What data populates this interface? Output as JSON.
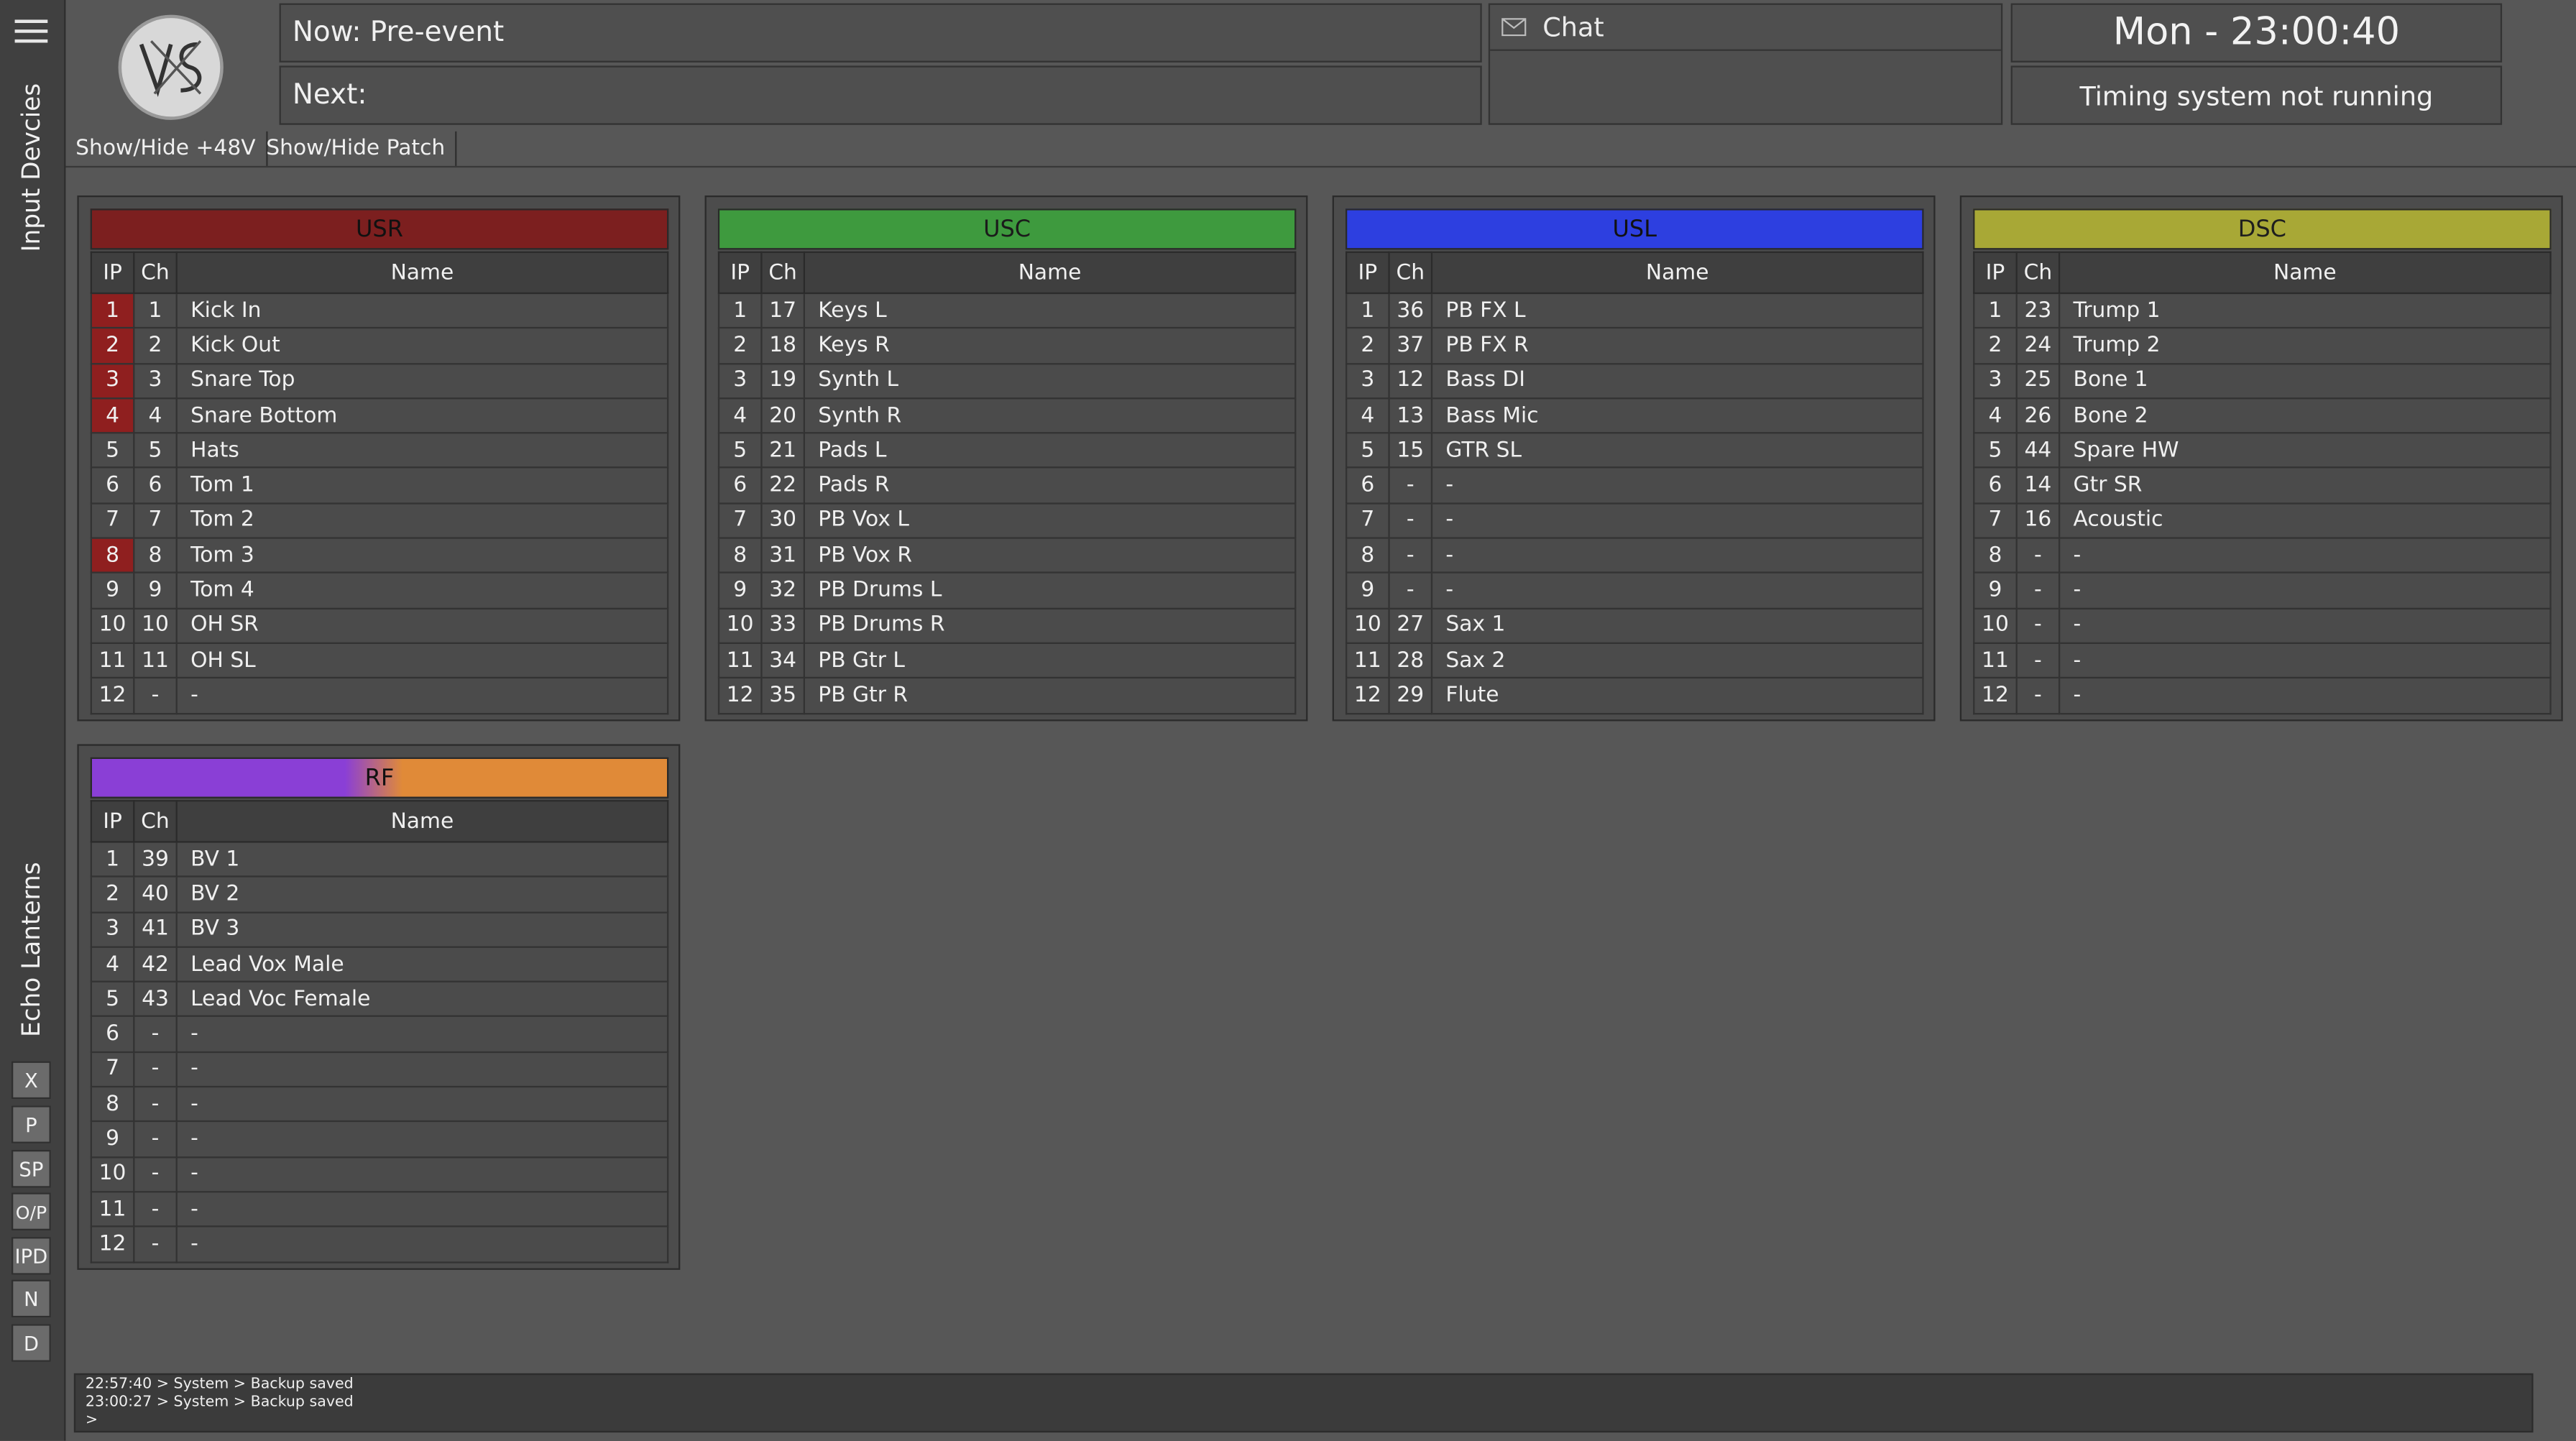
{
  "sidebar": {
    "tabs": [
      "Input Devcies",
      "Echo Lanterns"
    ],
    "buttons": [
      "X",
      "P",
      "SP",
      "O/P",
      "IPD",
      "N",
      "D"
    ]
  },
  "header": {
    "now_label": "Now: Pre-event",
    "next_label": "Next:",
    "chat_label": "Chat",
    "time": "Mon - 23:00:40",
    "timing_status": "Timing system not running"
  },
  "toolbar": {
    "show_hide_48v": "Show/Hide +48V",
    "show_hide_patch": "Show/Hide Patch"
  },
  "columns": {
    "ip": "IP",
    "ch": "Ch",
    "name": "Name"
  },
  "colors": {
    "usr": "#7c1f1f",
    "usc": "#3e9a3e",
    "usl": "#2d3fe0",
    "dsc": "#a8a836",
    "rf_left": "#8a3fd6",
    "rf_right": "#e08a38",
    "highlight": "#8f1f1f"
  },
  "panels": [
    {
      "title": "USR",
      "color_key": "usr",
      "rows": [
        {
          "ip": "1",
          "ch": "1",
          "name": "Kick In",
          "highlight": true
        },
        {
          "ip": "2",
          "ch": "2",
          "name": "Kick Out",
          "highlight": true
        },
        {
          "ip": "3",
          "ch": "3",
          "name": "Snare Top",
          "highlight": true
        },
        {
          "ip": "4",
          "ch": "4",
          "name": "Snare Bottom",
          "highlight": true
        },
        {
          "ip": "5",
          "ch": "5",
          "name": "Hats"
        },
        {
          "ip": "6",
          "ch": "6",
          "name": "Tom 1"
        },
        {
          "ip": "7",
          "ch": "7",
          "name": "Tom 2"
        },
        {
          "ip": "8",
          "ch": "8",
          "name": "Tom 3",
          "highlight": true
        },
        {
          "ip": "9",
          "ch": "9",
          "name": "Tom 4"
        },
        {
          "ip": "10",
          "ch": "10",
          "name": "OH SR"
        },
        {
          "ip": "11",
          "ch": "11",
          "name": "OH SL"
        },
        {
          "ip": "12",
          "ch": "-",
          "name": "-"
        }
      ]
    },
    {
      "title": "USC",
      "color_key": "usc",
      "rows": [
        {
          "ip": "1",
          "ch": "17",
          "name": "Keys L"
        },
        {
          "ip": "2",
          "ch": "18",
          "name": "Keys R"
        },
        {
          "ip": "3",
          "ch": "19",
          "name": "Synth L"
        },
        {
          "ip": "4",
          "ch": "20",
          "name": "Synth R"
        },
        {
          "ip": "5",
          "ch": "21",
          "name": "Pads L"
        },
        {
          "ip": "6",
          "ch": "22",
          "name": "Pads R"
        },
        {
          "ip": "7",
          "ch": "30",
          "name": "PB Vox L"
        },
        {
          "ip": "8",
          "ch": "31",
          "name": "PB Vox R"
        },
        {
          "ip": "9",
          "ch": "32",
          "name": "PB Drums L"
        },
        {
          "ip": "10",
          "ch": "33",
          "name": "PB Drums R"
        },
        {
          "ip": "11",
          "ch": "34",
          "name": "PB Gtr L"
        },
        {
          "ip": "12",
          "ch": "35",
          "name": "PB Gtr R"
        }
      ]
    },
    {
      "title": "USL",
      "color_key": "usl",
      "rows": [
        {
          "ip": "1",
          "ch": "36",
          "name": "PB FX L"
        },
        {
          "ip": "2",
          "ch": "37",
          "name": "PB FX R"
        },
        {
          "ip": "3",
          "ch": "12",
          "name": "Bass DI"
        },
        {
          "ip": "4",
          "ch": "13",
          "name": "Bass Mic"
        },
        {
          "ip": "5",
          "ch": "15",
          "name": "GTR SL"
        },
        {
          "ip": "6",
          "ch": "-",
          "name": "-"
        },
        {
          "ip": "7",
          "ch": "-",
          "name": "-"
        },
        {
          "ip": "8",
          "ch": "-",
          "name": "-"
        },
        {
          "ip": "9",
          "ch": "-",
          "name": "-"
        },
        {
          "ip": "10",
          "ch": "27",
          "name": "Sax 1"
        },
        {
          "ip": "11",
          "ch": "28",
          "name": "Sax 2"
        },
        {
          "ip": "12",
          "ch": "29",
          "name": "Flute"
        }
      ]
    },
    {
      "title": "DSC",
      "color_key": "dsc",
      "rows": [
        {
          "ip": "1",
          "ch": "23",
          "name": "Trump 1"
        },
        {
          "ip": "2",
          "ch": "24",
          "name": "Trump 2"
        },
        {
          "ip": "3",
          "ch": "25",
          "name": "Bone 1"
        },
        {
          "ip": "4",
          "ch": "26",
          "name": "Bone 2"
        },
        {
          "ip": "5",
          "ch": "44",
          "name": "Spare HW"
        },
        {
          "ip": "6",
          "ch": "14",
          "name": "Gtr SR"
        },
        {
          "ip": "7",
          "ch": "16",
          "name": "Acoustic"
        },
        {
          "ip": "8",
          "ch": "-",
          "name": "-"
        },
        {
          "ip": "9",
          "ch": "-",
          "name": "-"
        },
        {
          "ip": "10",
          "ch": "-",
          "name": "-"
        },
        {
          "ip": "11",
          "ch": "-",
          "name": "-"
        },
        {
          "ip": "12",
          "ch": "-",
          "name": "-"
        }
      ]
    },
    {
      "title": "RF",
      "color_key": "rf",
      "rows": [
        {
          "ip": "1",
          "ch": "39",
          "name": "BV 1"
        },
        {
          "ip": "2",
          "ch": "40",
          "name": "BV 2"
        },
        {
          "ip": "3",
          "ch": "41",
          "name": "BV 3"
        },
        {
          "ip": "4",
          "ch": "42",
          "name": "Lead Vox Male"
        },
        {
          "ip": "5",
          "ch": "43",
          "name": "Lead Voc Female"
        },
        {
          "ip": "6",
          "ch": "-",
          "name": "-"
        },
        {
          "ip": "7",
          "ch": "-",
          "name": "-"
        },
        {
          "ip": "8",
          "ch": "-",
          "name": "-"
        },
        {
          "ip": "9",
          "ch": "-",
          "name": "-"
        },
        {
          "ip": "10",
          "ch": "-",
          "name": "-"
        },
        {
          "ip": "11",
          "ch": "-",
          "name": "-"
        },
        {
          "ip": "12",
          "ch": "-",
          "name": "-"
        }
      ]
    }
  ],
  "log": {
    "lines": [
      "22:57:40 > System > Backup saved",
      "23:00:27 > System > Backup saved",
      ">"
    ]
  }
}
